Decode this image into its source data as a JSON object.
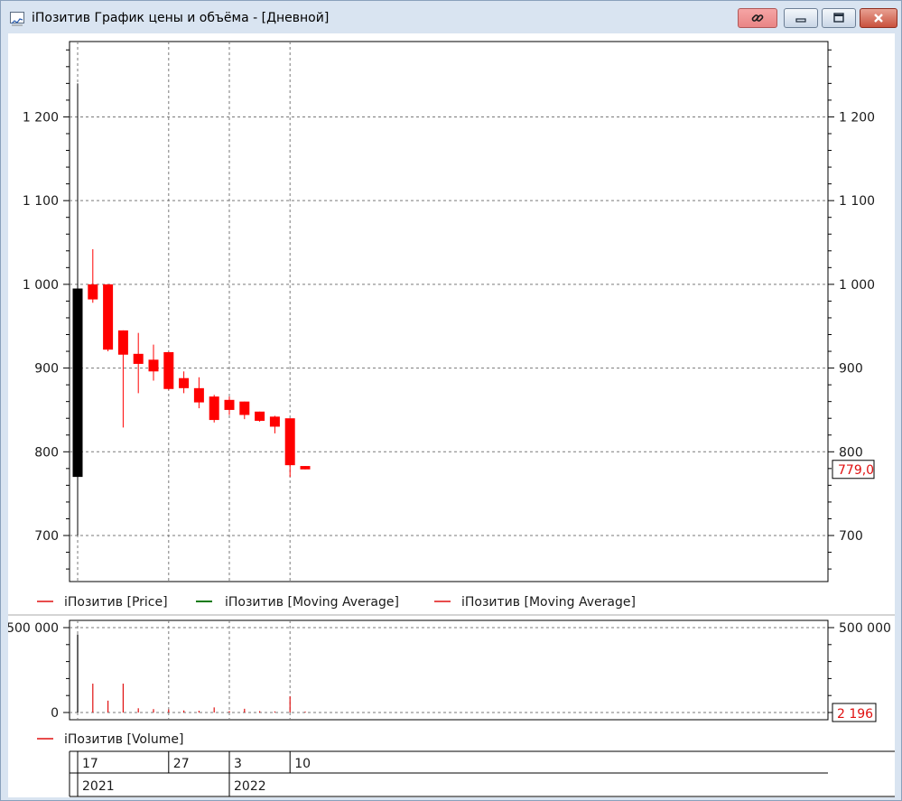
{
  "window": {
    "title": "iПозитив График цены и объёма - [Дневной]",
    "icons": {
      "app": "chart-window-icon",
      "link": "link-icon",
      "minimize": "minimize-icon",
      "maximize": "maximize-icon",
      "close": "close-icon"
    }
  },
  "colors": {
    "up": "#000000",
    "down": "#ff0000",
    "volume": "#e01010",
    "ma_green": "#0a7a0a",
    "ma_red": "#e01010",
    "grid": "#7a7a7a"
  },
  "chart_data": [
    {
      "type": "candlestick",
      "ylim": [
        645,
        1290
      ],
      "y_ticks": [
        700,
        800,
        900,
        1000,
        1100,
        1200
      ],
      "y_tick_labels": [
        "700",
        "800",
        "900",
        "1 000",
        "1 100",
        "1 200"
      ],
      "candles": [
        {
          "open": 770,
          "high": 1240,
          "low": 700,
          "close": 995
        },
        {
          "open": 1000,
          "high": 1042,
          "low": 978,
          "close": 982
        },
        {
          "open": 1000,
          "high": 1000,
          "low": 920,
          "close": 922
        },
        {
          "open": 945,
          "high": 945,
          "low": 829,
          "close": 916
        },
        {
          "open": 917,
          "high": 942,
          "low": 870,
          "close": 905
        },
        {
          "open": 910,
          "high": 928,
          "low": 885,
          "close": 896
        },
        {
          "open": 919,
          "high": 919,
          "low": 874,
          "close": 875
        },
        {
          "open": 888,
          "high": 896,
          "low": 870,
          "close": 876
        },
        {
          "open": 876,
          "high": 889,
          "low": 852,
          "close": 859
        },
        {
          "open": 866,
          "high": 868,
          "low": 835,
          "close": 838
        },
        {
          "open": 862,
          "high": 866,
          "low": 844,
          "close": 850
        },
        {
          "open": 860,
          "high": 860,
          "low": 839,
          "close": 844
        },
        {
          "open": 848,
          "high": 848,
          "low": 836,
          "close": 837
        },
        {
          "open": 842,
          "high": 843,
          "low": 822,
          "close": 830
        },
        {
          "open": 840,
          "high": 840,
          "low": 770,
          "close": 784
        },
        {
          "open": 783,
          "high": 783,
          "low": 779,
          "close": 779
        }
      ],
      "last_value_label": "779,0",
      "legend": [
        "iПозитив [Price]",
        "iПозитив [Moving Average]",
        "iПозитив [Moving Average]"
      ]
    },
    {
      "type": "bar",
      "ylim": [
        0,
        500000
      ],
      "y_ticks": [
        0,
        500000
      ],
      "y_tick_labels": [
        "0",
        "500 000"
      ],
      "values": [
        460000,
        170000,
        70000,
        170000,
        25000,
        20000,
        18000,
        12000,
        10000,
        30000,
        8000,
        22000,
        8000,
        6000,
        95000,
        2196
      ],
      "last_value_label": "2 196",
      "legend": [
        "iПозитив [Volume]"
      ]
    }
  ],
  "timeline": {
    "days": [
      {
        "label": "17",
        "index": 0
      },
      {
        "label": "27",
        "index": 6
      },
      {
        "label": "3",
        "index": 10
      },
      {
        "label": "10",
        "index": 14
      }
    ],
    "years": [
      {
        "label": "2021",
        "index": 0
      },
      {
        "label": "2022",
        "index": 10
      }
    ]
  }
}
